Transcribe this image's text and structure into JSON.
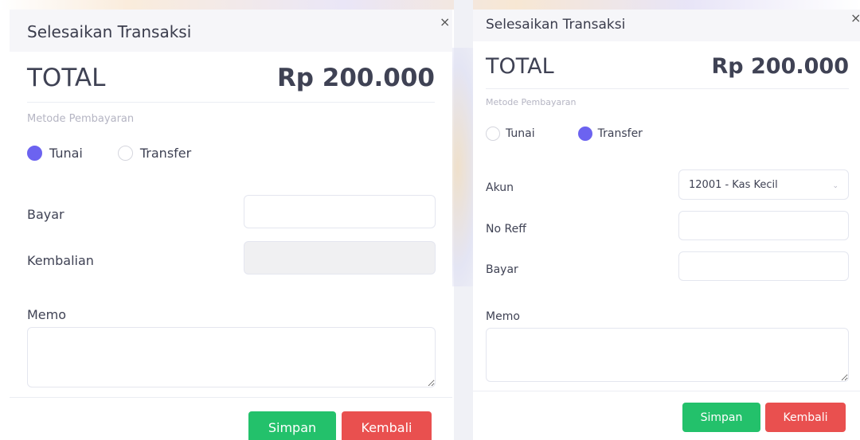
{
  "left_modal": {
    "title": "Selesaikan Transaksi",
    "close_symbol": "×",
    "total_label": "TOTAL",
    "total_value": "Rp 200.000",
    "payment_method_label": "Metode Pembayaran",
    "payment_options": [
      {
        "label": "Tunai",
        "selected": true
      },
      {
        "label": "Transfer",
        "selected": false
      }
    ],
    "fields": {
      "bayar_label": "Bayar",
      "bayar_value": "",
      "kembalian_label": "Kembalian",
      "kembalian_value": "",
      "memo_label": "Memo",
      "memo_value": ""
    },
    "buttons": {
      "save": "Simpan",
      "back": "Kembali"
    }
  },
  "right_modal": {
    "title": "Selesaikan Transaksi",
    "close_symbol": "×",
    "total_label": "TOTAL",
    "total_value": "Rp 200.000",
    "payment_method_label": "Metode Pembayaran",
    "payment_options": [
      {
        "label": "Tunai",
        "selected": false
      },
      {
        "label": "Transfer",
        "selected": true
      }
    ],
    "fields": {
      "akun_label": "Akun",
      "akun_value": "12001 - Kas Kecil",
      "no_reff_label": "No Reff",
      "no_reff_value": "",
      "bayar_label": "Bayar",
      "bayar_value": "",
      "memo_label": "Memo",
      "memo_value": ""
    },
    "buttons": {
      "save": "Simpan",
      "back": "Kembali"
    }
  },
  "colors": {
    "accent": "#6c63f0",
    "save_button": "#23c16b",
    "back_button": "#e9504f",
    "header_bg": "#f6f6f9",
    "muted_text": "#b5b5c3"
  },
  "icons": {
    "close": "close-icon",
    "dropdown": "chevron-down-icon"
  }
}
